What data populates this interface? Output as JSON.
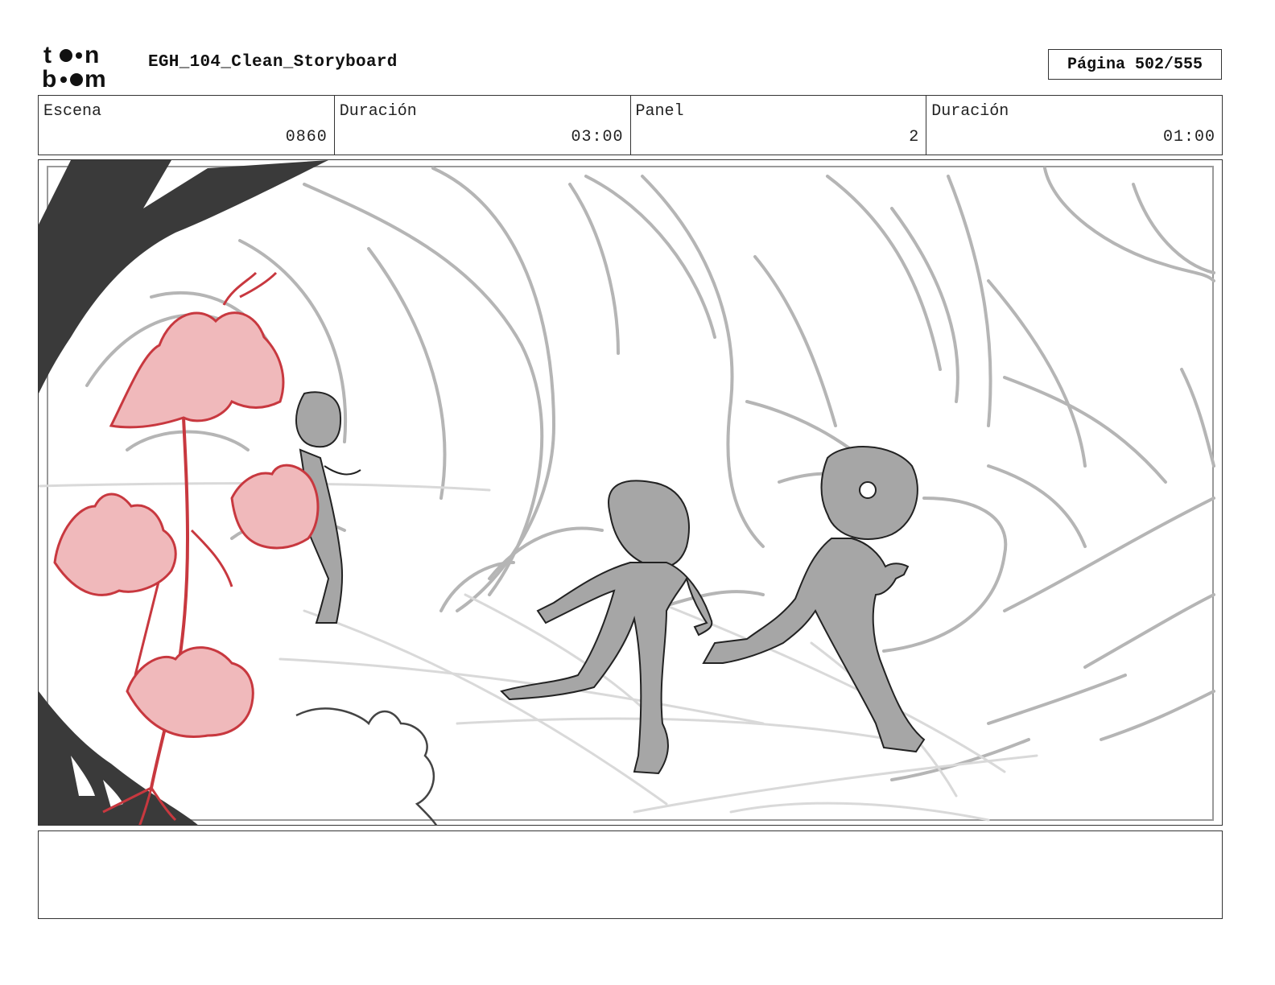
{
  "header": {
    "logo_top": "toon",
    "logo_bottom": "boom",
    "title": "EGH_104_Clean_Storyboard",
    "page": "Página 502/555"
  },
  "info": {
    "scene_label": "Escena",
    "scene_value": "0860",
    "scene_duration_label": "Duración",
    "scene_duration_value": "03:00",
    "panel_label": "Panel",
    "panel_value": "2",
    "panel_duration_label": "Duración",
    "panel_duration_value": "01:00"
  },
  "notes": {
    "text": ""
  },
  "colors": {
    "ink": "#222222",
    "fill_gray": "#a6a6a6",
    "dark_tree": "#3a3a3a",
    "sketch": "#b3b3b3",
    "flower_fill": "#f0b9bb",
    "flower_line": "#c8383f"
  }
}
